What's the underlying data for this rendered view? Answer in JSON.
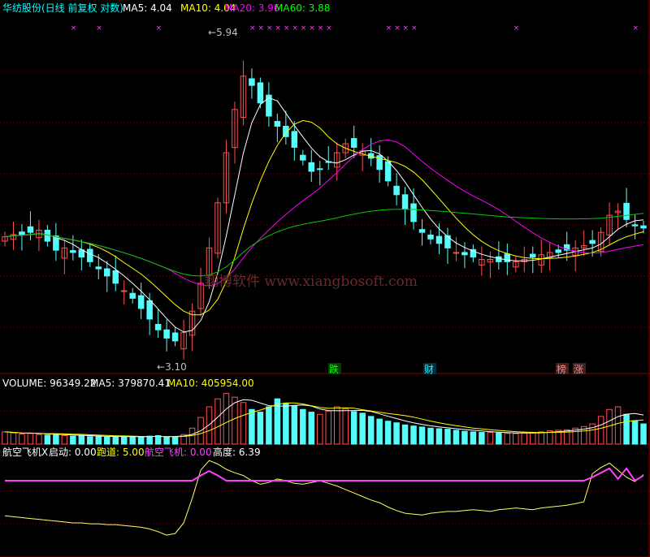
{
  "colors": {
    "background": "#000000",
    "grid": "#8b0000",
    "up": "#ff5050",
    "down": "#54fcfc",
    "ma5": "#ffffff",
    "ma10": "#ffff00",
    "ma20": "#ff00ff",
    "ma60": "#00cc00",
    "signal": "#ff40ff",
    "cyan_text": "#00ffff",
    "watermark": "#6a2a2a"
  },
  "chart_data": [
    {
      "type": "candlestick",
      "panel": "price",
      "title": "华纺股份(日线 前复权 对数)",
      "indicators": [
        {
          "name": "MA5",
          "label": "MA5: ",
          "value": "4.04"
        },
        {
          "name": "MA10",
          "label": "MA10: ",
          "value": "4.04"
        },
        {
          "name": "MA20",
          "label": "MA20: ",
          "value": "3.96"
        },
        {
          "name": "MA60",
          "label": "MA60: ",
          "value": "3.88"
        }
      ],
      "high_label": "5.94",
      "low_label": "3.10",
      "event_markers": [
        {
          "label": "跌",
          "color": "#00ff00"
        },
        {
          "label": "财",
          "color": "#00ffff"
        },
        {
          "label": "榜",
          "color": "#ff8080"
        },
        {
          "label": "涨",
          "color": "#ff8080"
        }
      ],
      "signal_glyph": "×",
      "log_scale": true,
      "ylim": [
        2.95,
        6.5
      ],
      "close": [
        3.96,
        3.98,
        3.98,
        4.0,
        4.02,
        3.92,
        3.84,
        3.86,
        3.82,
        3.78,
        3.74,
        3.68,
        3.62,
        3.56,
        3.5,
        3.44,
        3.36,
        3.28,
        3.2,
        3.14,
        3.12,
        3.18,
        3.34,
        3.56,
        3.86,
        4.28,
        4.8,
        5.3,
        5.72,
        5.6,
        5.38,
        5.22,
        5.1,
        4.98,
        4.86,
        4.72,
        4.6,
        4.62,
        4.7,
        4.8,
        4.9,
        4.86,
        4.82,
        4.74,
        4.62,
        4.5,
        4.36,
        4.22,
        4.1,
        4.0,
        3.94,
        3.9,
        3.86,
        3.82,
        3.8,
        3.78,
        3.76,
        3.76,
        3.74,
        3.74,
        3.74,
        3.76,
        3.78,
        3.8,
        3.82,
        3.82,
        3.84,
        3.86,
        3.88,
        3.9,
        4.0,
        4.16,
        4.2,
        4.12,
        4.06,
        4.04
      ]
    },
    {
      "type": "bar",
      "panel": "volume",
      "label": "VOLUME: ",
      "value": "96349.22",
      "indicators": [
        {
          "name": "MA5",
          "label": "MA5: ",
          "value": "379870.41"
        },
        {
          "name": "MA10",
          "label": "MA10: ",
          "value": "405954.00"
        }
      ],
      "ylim": [
        0,
        1020000
      ],
      "values": [
        230000,
        210000,
        190000,
        200000,
        180000,
        170000,
        190000,
        160000,
        150000,
        160000,
        140000,
        150000,
        130000,
        140000,
        150000,
        130000,
        140000,
        150000,
        160000,
        130000,
        140000,
        180000,
        300000,
        500000,
        700000,
        850000,
        950000,
        880000,
        780000,
        650000,
        600000,
        700000,
        850000,
        760000,
        720000,
        650000,
        600000,
        560000,
        620000,
        700000,
        660000,
        610000,
        580000,
        520000,
        470000,
        430000,
        400000,
        360000,
        340000,
        320000,
        300000,
        290000,
        280000,
        260000,
        240000,
        230000,
        220000,
        220000,
        210000,
        200000,
        200000,
        210000,
        220000,
        230000,
        250000,
        260000,
        270000,
        300000,
        330000,
        380000,
        520000,
        650000,
        700000,
        560000,
        440000,
        380000
      ]
    },
    {
      "type": "line",
      "panel": "indicator",
      "name": "航空飞机X",
      "readouts": [
        {
          "label": "启动: ",
          "value": "0.00",
          "color": "#ffffff"
        },
        {
          "label": "跑道: ",
          "value": "5.00",
          "color": "#ffff00"
        },
        {
          "label": "航空飞机: ",
          "value": "0.00",
          "color": "#ff40ff"
        },
        {
          "label": "高度: ",
          "value": "6.39",
          "color": "#ffffff"
        }
      ],
      "ylim": [
        -3.5,
        7.5
      ],
      "runway": 5.0,
      "height": [
        1.0,
        0.9,
        0.8,
        0.7,
        0.6,
        0.5,
        0.4,
        0.3,
        0.2,
        0.2,
        0.1,
        0.1,
        0.0,
        0.0,
        -0.1,
        -0.2,
        -0.3,
        -0.5,
        -0.8,
        -1.2,
        -1.0,
        0.2,
        3.0,
        6.2,
        7.3,
        6.9,
        6.3,
        5.9,
        5.6,
        5.0,
        4.6,
        4.8,
        5.2,
        5.0,
        4.7,
        4.6,
        4.8,
        5.0,
        4.7,
        4.4,
        4.0,
        3.6,
        3.2,
        2.8,
        2.5,
        2.0,
        1.6,
        1.3,
        1.2,
        1.1,
        1.3,
        1.4,
        1.5,
        1.5,
        1.6,
        1.7,
        1.6,
        1.5,
        1.7,
        1.8,
        1.9,
        1.8,
        1.7,
        1.9,
        2.0,
        2.1,
        2.2,
        2.4,
        2.6,
        5.8,
        6.5,
        7.0,
        6.2,
        5.4,
        4.9,
        5.7
      ],
      "signal": [
        5.0,
        5.0,
        5.0,
        5.0,
        5.0,
        5.0,
        5.0,
        5.0,
        5.0,
        5.0,
        5.0,
        5.0,
        5.0,
        5.0,
        5.0,
        5.0,
        5.0,
        5.0,
        5.0,
        5.0,
        5.0,
        5.0,
        5.0,
        5.6,
        6.1,
        5.6,
        5.0,
        5.0,
        5.0,
        5.0,
        5.0,
        5.0,
        5.0,
        5.0,
        5.0,
        5.0,
        5.0,
        5.0,
        5.0,
        5.0,
        5.0,
        5.0,
        5.0,
        5.0,
        5.0,
        5.0,
        5.0,
        5.0,
        5.0,
        5.0,
        5.0,
        5.0,
        5.0,
        5.0,
        5.0,
        5.0,
        5.0,
        5.0,
        5.0,
        5.0,
        5.0,
        5.0,
        5.0,
        5.0,
        5.0,
        5.0,
        5.0,
        5.0,
        5.0,
        5.4,
        5.9,
        6.4,
        5.2,
        6.4,
        5.0,
        5.6
      ]
    }
  ],
  "watermark": "翔博软件 www.xiangbosoft.com"
}
